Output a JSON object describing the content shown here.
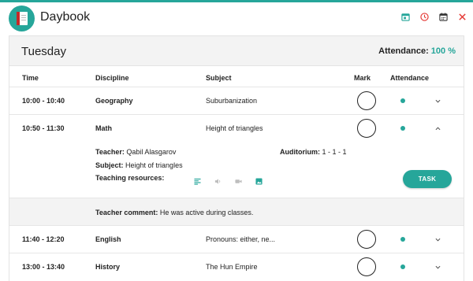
{
  "app": {
    "title": "Daybook"
  },
  "header_icons": [
    "calendar-day-icon",
    "clock-icon",
    "calendar-icon",
    "close-icon"
  ],
  "colors": {
    "accent": "#26a69a",
    "danger": "#e53935",
    "header_bg": "#f3f3f3"
  },
  "day": {
    "name": "Tuesday",
    "attendance_label": "Attendance:",
    "attendance_value": "100 %"
  },
  "columns": {
    "time": "Time",
    "discipline": "Discipline",
    "subject": "Subject",
    "mark": "Mark",
    "attendance": "Attendance"
  },
  "lessons": [
    {
      "time": "10:00 - 10:40",
      "discipline": "Geography",
      "subject": "Suburbanization",
      "present": true,
      "expanded": false
    },
    {
      "time": "10:50 - 11:30",
      "discipline": "Math",
      "subject": "Height of triangles",
      "present": true,
      "expanded": true
    },
    {
      "time": "11:40 - 12:20",
      "discipline": "English",
      "subject": "Pronouns: either, ne...",
      "present": true,
      "expanded": false
    },
    {
      "time": "13:00 - 13:40",
      "discipline": "History",
      "subject": "The Hun Empire",
      "present": true,
      "expanded": false
    }
  ],
  "detail": {
    "teacher_label": "Teacher:",
    "teacher": "Qabil Alasgarov",
    "auditorium_label": "Auditorium:",
    "auditorium": "1 - 1 - 1",
    "subject_label": "Subject:",
    "subject": "Height of triangles",
    "resources_label": "Teaching resources:",
    "resource_icons": [
      "text-resource-icon",
      "audio-resource-icon",
      "video-resource-icon",
      "image-resource-icon"
    ],
    "task_button": "TASK",
    "comment_label": "Teacher comment:",
    "comment": "He was active during classes."
  }
}
